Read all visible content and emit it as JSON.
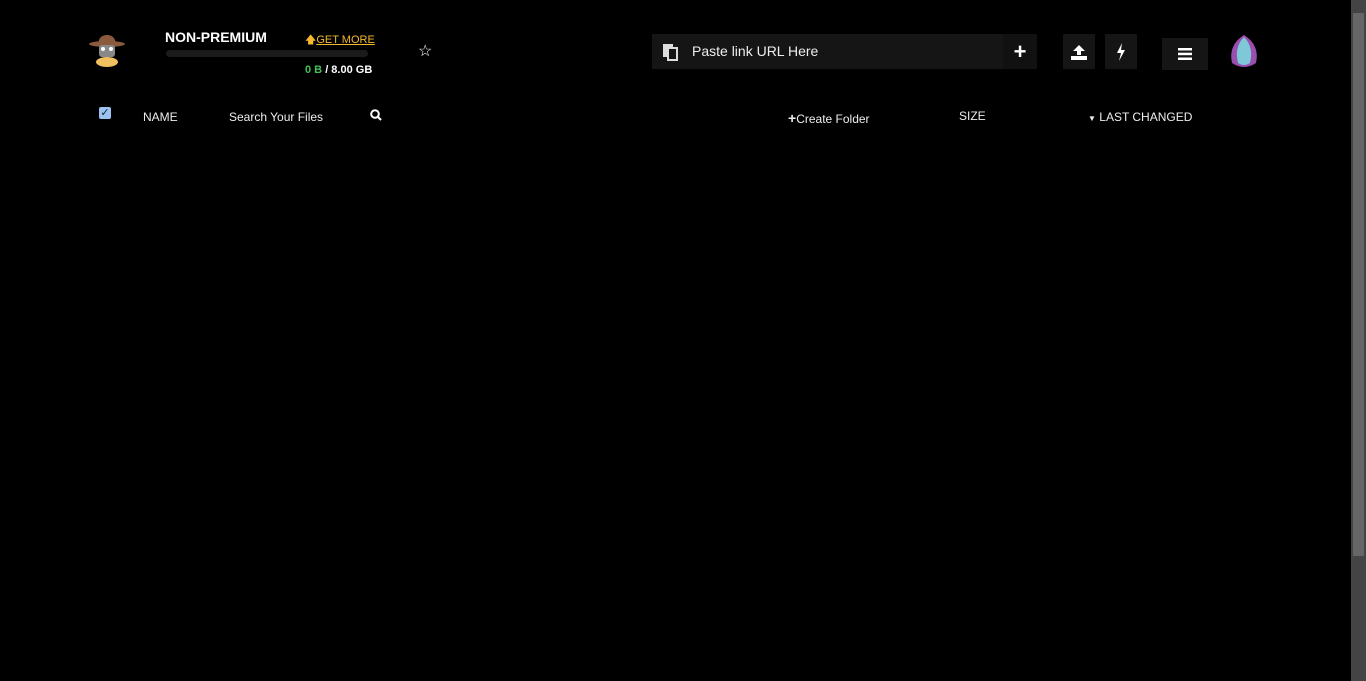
{
  "account": {
    "plan": "NON-PREMIUM",
    "get_more": "GET MORE",
    "used": "0 B",
    "total": "/ 8.00 GB",
    "usage_fraction": 0
  },
  "url_input": {
    "placeholder": "Paste link URL Here"
  },
  "icons": {
    "logo": "ninja-hat-mascot",
    "favorite": "star-icon",
    "clipboard": "paste-icon",
    "add": "plus-icon",
    "upload": "upload-icon",
    "flash": "bolt-icon",
    "menu": "hamburger-icon",
    "profile": "lotus-logo"
  },
  "table_header": {
    "name": "NAME",
    "search_placeholder": "Search Your Files",
    "create_folder": "Create Folder",
    "size": "SIZE",
    "last_changed": "LAST CHANGED"
  },
  "colors": {
    "accent": "#f5b82e",
    "used": "#3fc15b"
  }
}
